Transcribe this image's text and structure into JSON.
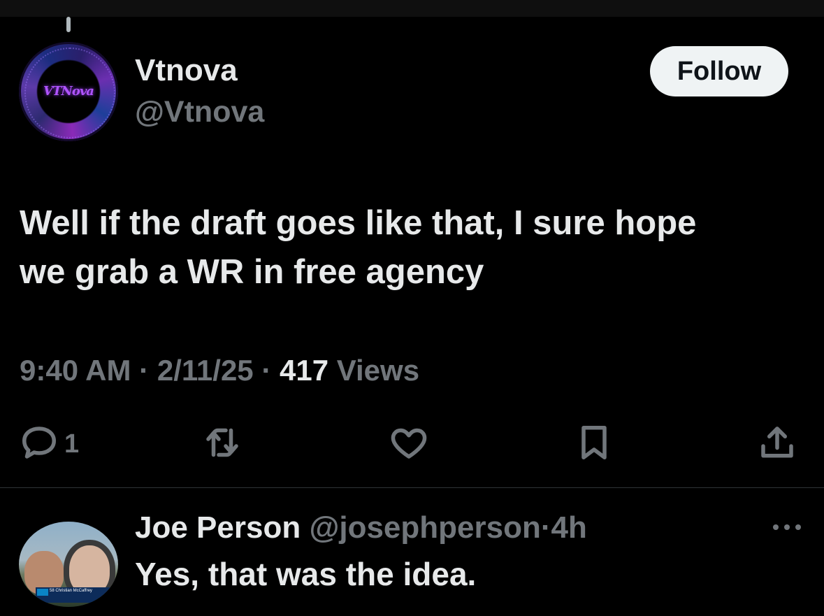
{
  "author": {
    "avatar_logo_text": "VTNova",
    "name": "Vtnova",
    "handle": "@Vtnova"
  },
  "follow_label": "Follow",
  "tweet": {
    "text_line1": "Well if the draft goes like that, I sure hope",
    "text_line2": "we grab a WR in free agency",
    "time": "9:40 AM",
    "sep": "·",
    "date": "2/11/25",
    "views_count": "417",
    "views_label": "Views"
  },
  "actions": {
    "reply_count": "1",
    "icons": [
      "reply-icon",
      "retweet-icon",
      "like-icon",
      "bookmark-icon",
      "share-icon"
    ]
  },
  "reply": {
    "name": "Joe Person",
    "handle": "@josephperson",
    "sep": "·",
    "time": "4h",
    "text": "Yes, that was the idea.",
    "avatar_caption": "58 Christian McCaffrey"
  },
  "colors": {
    "background": "#000000",
    "primary_text": "#e7e9ea",
    "secondary_text": "#71767b",
    "button_bg": "#eff3f4",
    "divider": "#2f3336"
  }
}
